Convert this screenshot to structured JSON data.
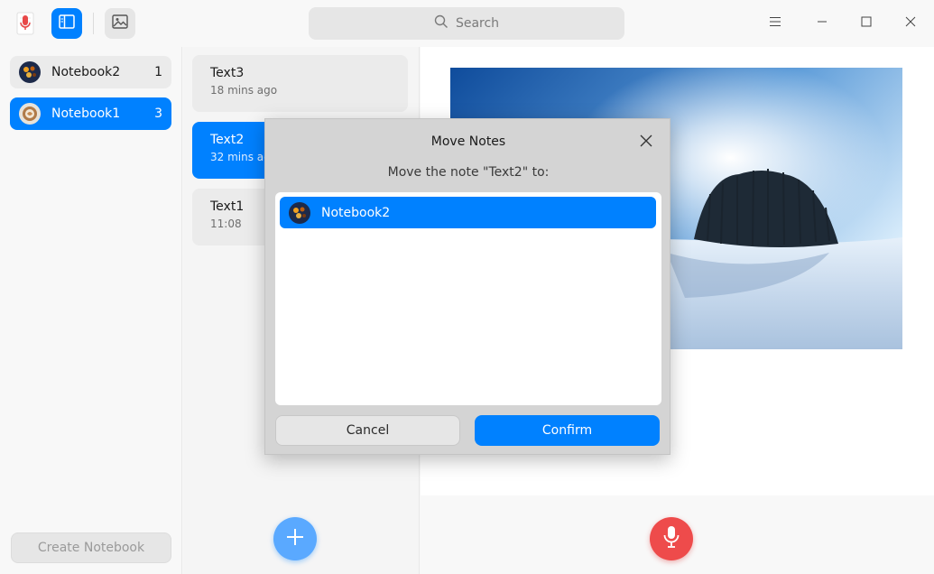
{
  "titlebar": {
    "search_placeholder": "Search",
    "icons": {
      "app": "voice-notes-app-icon",
      "sidebar_toggle": "sidebar-icon",
      "insert_image": "image-icon",
      "search": "search-icon",
      "menu": "menu-icon",
      "minimize": "minimize-icon",
      "maximize": "maximize-icon",
      "close": "close-icon"
    },
    "accent_color": "#0081ff"
  },
  "notebooks": {
    "items": [
      {
        "name": "Notebook2",
        "count": "1",
        "selected": false
      },
      {
        "name": "Notebook1",
        "count": "3",
        "selected": true
      }
    ],
    "create_label": "Create Notebook"
  },
  "notes": {
    "items": [
      {
        "title": "Text3",
        "time": "18 mins ago",
        "selected": false
      },
      {
        "title": "Text2",
        "time": "32 mins ago",
        "selected": true
      },
      {
        "title": "Text1",
        "time": "11:08",
        "selected": false
      }
    ],
    "add_icon": "plus-icon"
  },
  "editor": {
    "image_subject": "snowy landscape with tree grove under blue sky",
    "record_icon": "microphone-icon",
    "record_color": "#ee4b4b"
  },
  "dialog": {
    "title": "Move Notes",
    "message": "Move the note \"Text2\" to:",
    "options": [
      {
        "name": "Notebook2",
        "selected": true
      }
    ],
    "cancel_label": "Cancel",
    "confirm_label": "Confirm"
  }
}
